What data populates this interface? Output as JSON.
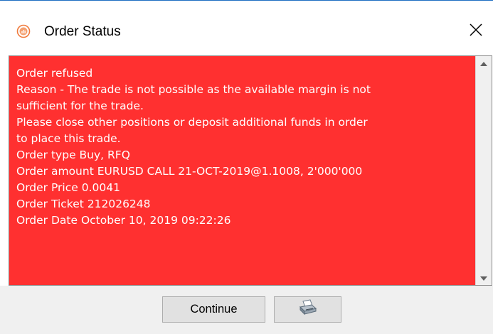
{
  "window": {
    "title": "Order Status"
  },
  "message": {
    "lines": [
      "Order refused",
      "Reason - The trade is not possible as the available margin is not",
      "sufficient for the trade.",
      "Please close other positions or deposit additional funds in order",
      "to place this trade.",
      "Order type Buy, RFQ",
      "Order amount EURUSD CALL 21-OCT-2019@1.1008, 2'000'000",
      "Order Price 0.0041",
      "Order Ticket 212026248",
      "Order Date October 10, 2019 09:22:26"
    ],
    "background_color": "#ff3030",
    "text_color": "#ffffff"
  },
  "buttons": {
    "continue_label": "Continue",
    "print_icon": "printer-icon"
  },
  "icons": {
    "app": "app-logo-icon",
    "close": "close-icon",
    "scroll_up": "scroll-up-arrow-icon",
    "scroll_down": "scroll-down-arrow-icon"
  }
}
